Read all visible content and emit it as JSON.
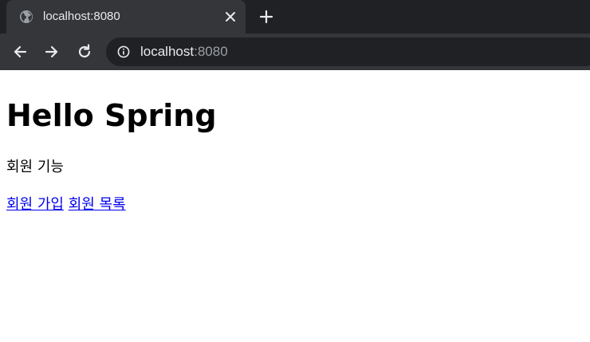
{
  "browser": {
    "tab": {
      "title": "localhost:8080"
    },
    "address_bar": {
      "host": "localhost",
      "port": ":8080"
    },
    "icons": {
      "favicon": "globe-icon",
      "tab_close": "close-icon",
      "new_tab": "plus-icon",
      "back": "arrow-left-icon",
      "forward": "arrow-right-icon",
      "reload": "reload-icon",
      "site_info": "info-icon"
    },
    "colors": {
      "frame": "#202124",
      "active_tab": "#35363a",
      "text": "#e8eaed",
      "muted_text": "#9aa0a6"
    }
  },
  "page": {
    "heading": "Hello Spring",
    "section_text": "회원 기능",
    "links": [
      {
        "label": "회원 가입"
      },
      {
        "label": "회원 목록"
      }
    ],
    "colors": {
      "link": "#0000ee",
      "text": "#000000",
      "background": "#ffffff"
    }
  }
}
